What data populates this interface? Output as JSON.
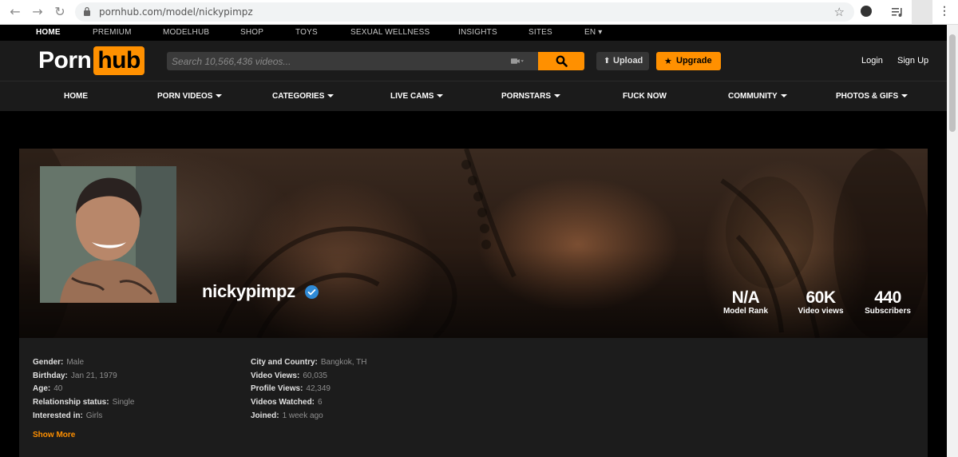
{
  "browser": {
    "back_icon": "arrow-left-icon",
    "forward_icon": "arrow-right-icon",
    "reload_icon": "reload-icon",
    "url": "pornhub.com/model/nickypimpz"
  },
  "topnav": [
    "HOME",
    "PREMIUM",
    "MODELHUB",
    "SHOP",
    "TOYS",
    "SEXUAL WELLNESS",
    "INSIGHTS",
    "SITES",
    "EN ▾"
  ],
  "header": {
    "logo_left": "Porn",
    "logo_right": "hub",
    "search_placeholder": "Search 10,566,436 videos...",
    "upload_label": "Upload",
    "upgrade_label": "Upgrade",
    "login_label": "Login",
    "signup_label": "Sign Up",
    "accent_color": "#ff9000"
  },
  "mainnav": [
    "HOME",
    "PORN VIDEOS",
    "CATEGORIES",
    "LIVE CAMS",
    "PORNSTARS",
    "FUCK NOW",
    "COMMUNITY",
    "PHOTOS & GIFS"
  ],
  "profile": {
    "username": "nickypimpz",
    "stats": [
      {
        "value": "N/A",
        "label": "Model Rank"
      },
      {
        "value": "60K",
        "label": "Video views"
      },
      {
        "value": "440",
        "label": "Subscribers"
      }
    ]
  },
  "info": {
    "left": [
      {
        "key": "Gender:",
        "value": "Male"
      },
      {
        "key": "Birthday:",
        "value": "Jan 21, 1979"
      },
      {
        "key": "Age:",
        "value": "40"
      },
      {
        "key": "Relationship status:",
        "value": "Single"
      },
      {
        "key": "Interested in:",
        "value": "Girls"
      }
    ],
    "right": [
      {
        "key": "City and Country:",
        "value": "Bangkok, TH"
      },
      {
        "key": "Video Views:",
        "value": "60,035"
      },
      {
        "key": "Profile Views:",
        "value": "42,349"
      },
      {
        "key": "Videos Watched:",
        "value": "6"
      },
      {
        "key": "Joined:",
        "value": "1 week ago"
      }
    ],
    "show_more": "Show More"
  }
}
